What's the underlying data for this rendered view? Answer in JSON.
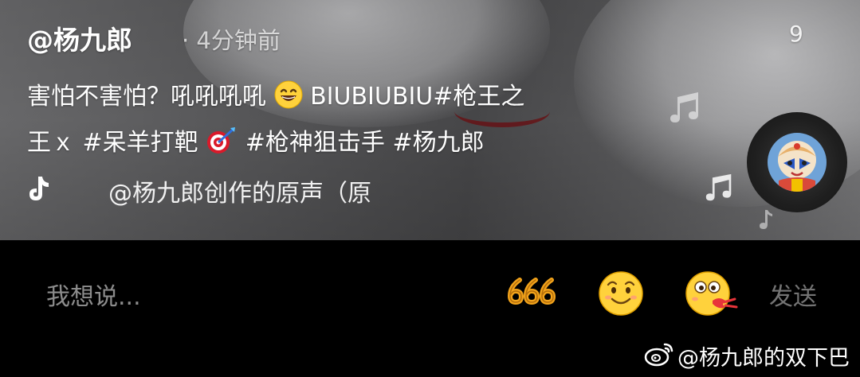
{
  "post": {
    "author": "@杨九郎",
    "time": "· 4分钟前",
    "count": "9",
    "caption_part1": "害怕不害怕？吼吼吼吼",
    "caption_part2": "BIUBIUBIU#枪王之",
    "caption_part3": "王ｘ #呆羊打靶",
    "caption_part4": "#枪神狙击手 #杨九郎",
    "emoji_1": "grinning-face",
    "emoji_2": "direct-hit-dart"
  },
  "music": {
    "icon": "tiktok-note-icon",
    "text": "@杨九郎创作的原声（原"
  },
  "comment_bar": {
    "placeholder": "我想说...",
    "quick_emoji": [
      "666",
      "smile",
      "drooling-kiss"
    ],
    "send_label": "发送"
  },
  "watermark": {
    "text": "@杨九郎的双下巴",
    "icon": "weibo-icon"
  },
  "colors": {
    "accent_gold": "#f2a31b",
    "emoji_yellow": "#ffd23c",
    "background": "#000000"
  }
}
